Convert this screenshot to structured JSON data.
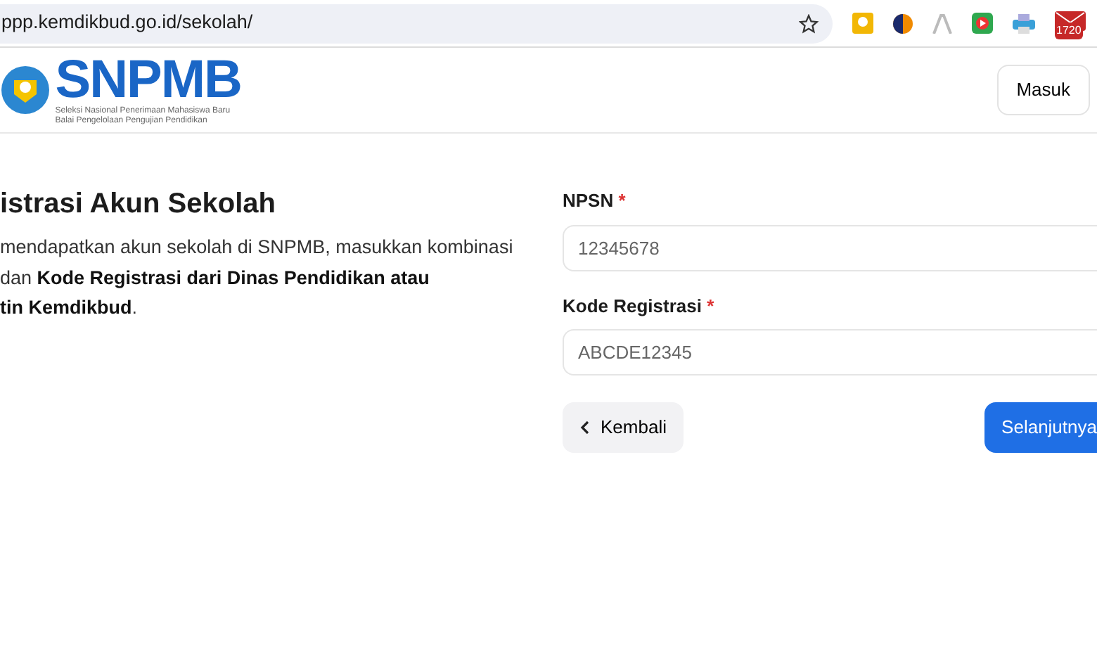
{
  "browser": {
    "url": "ppp.kemdikbud.go.id/sekolah/",
    "extension_badge": "1720"
  },
  "header": {
    "logo_text": "SNPMB",
    "logo_subtitle": "Seleksi Nasional Penerimaan Mahasiswa Baru",
    "logo_caption": "Balai Pengelolaan Pengujian Pendidikan",
    "login_button": "Masuk"
  },
  "intro": {
    "title": "istrasi Akun Sekolah",
    "text": "mendapatkan akun sekolah di SNPMB, masukkan kombinasi\n dan **Kode Registrasi dari Dinas Pendidikan atau**\n**tin Kemdikbud**."
  },
  "form": {
    "fields": [
      {
        "label": "NPSN",
        "required_mark": "*",
        "placeholder": "12345678"
      },
      {
        "label": "Kode Registrasi",
        "required_mark": "*",
        "placeholder": "ABCDE12345"
      }
    ],
    "back_button": "Kembali",
    "next_button": "Selanjutnya"
  }
}
